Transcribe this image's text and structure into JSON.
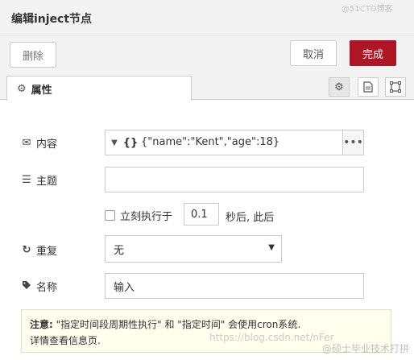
{
  "dialog": {
    "title": "编辑inject节点"
  },
  "toolbar": {
    "delete_label": "删除",
    "cancel_label": "取消",
    "done_label": "完成",
    "accent_color": "#ad1625"
  },
  "tabs": {
    "properties_label": "属性",
    "icons": [
      "gear-icon",
      "document-icon",
      "frame-icon"
    ]
  },
  "form": {
    "payload": {
      "label": "内容",
      "type_icon": "{}",
      "value": "{\"name\":\"Kent\",\"age\":18}"
    },
    "topic": {
      "label": "主题",
      "value": ""
    },
    "once": {
      "label": "立刻执行于",
      "delay_value": "0.1",
      "after_text": "秒后, 此后",
      "checked": false
    },
    "repeat": {
      "label": "重复",
      "selected": "无"
    },
    "name": {
      "label": "名称",
      "value": "输入"
    }
  },
  "tip": {
    "bold": "注意:",
    "line1": " \"指定时间段周期性执行\" 和 \"指定时间\" 会使用cron系统.",
    "line2": "详情查看信息页."
  },
  "watermarks": {
    "url": "https://blog.csdn.net/nFer",
    "brand": "@51CTO博客",
    "brand2": "@硕士毕业技术打拼"
  }
}
